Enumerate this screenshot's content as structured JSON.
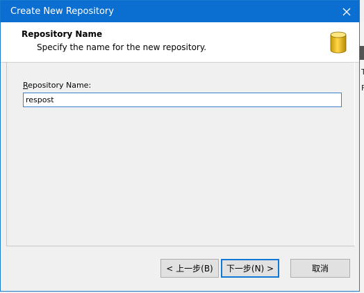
{
  "window": {
    "title": "Create New Repository"
  },
  "header": {
    "title": "Repository Name",
    "subtitle": "Specify the name for the new repository.",
    "icon": "database-icon"
  },
  "form": {
    "label_mnemonic": "R",
    "label_rest": "epository Name:",
    "value": "respost"
  },
  "buttons": {
    "back": "< 上一步(B)",
    "next": "下一步(N) >",
    "cancel": "取消"
  },
  "background_app": {
    "text1": "T",
    "text2": "F"
  },
  "colors": {
    "titlebar": "#0b6ed1",
    "accent": "#0f78d7",
    "icon_gold": "#e6b800"
  }
}
